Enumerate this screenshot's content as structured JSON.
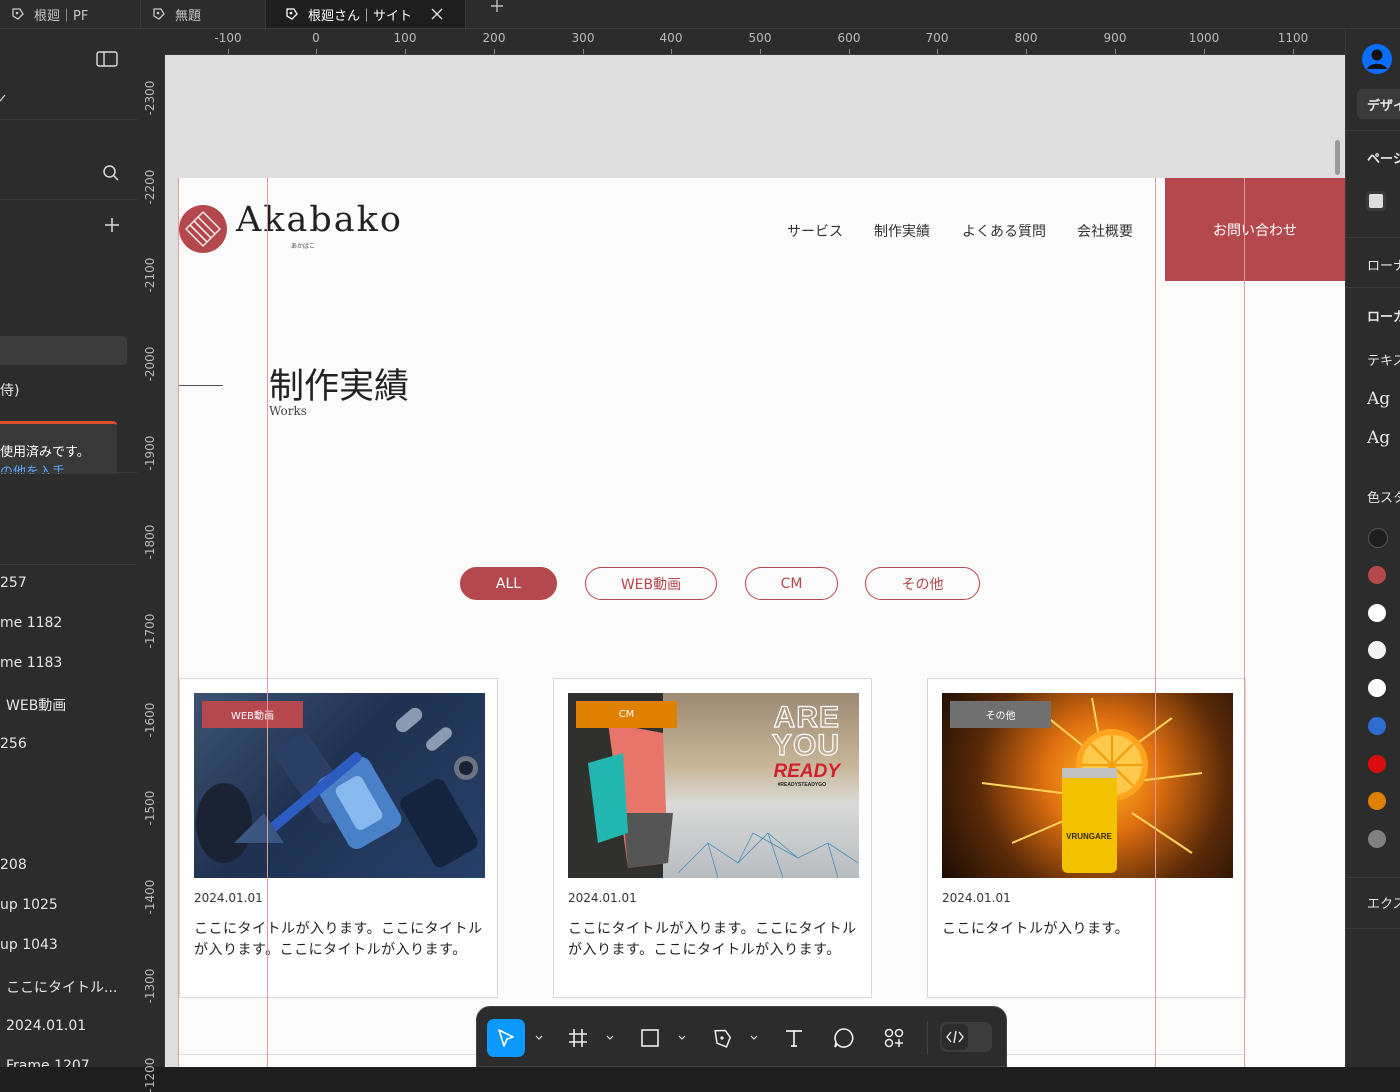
{
  "tabs": [
    {
      "label": "根廻｜PF",
      "active": false
    },
    {
      "label": "無題",
      "active": false
    },
    {
      "label": "根廻さん｜サイト",
      "active": true
    }
  ],
  "left_panel": {
    "layer_items": [
      "侍)",
      "257",
      "me 1182",
      "me 1183",
      "WEB動画",
      "256",
      "208",
      "up 1025",
      "up 1043",
      "ここにタイトル...",
      "2024.01.01",
      "Frame 1207"
    ],
    "notice_line1": "使用済みです。",
    "notice_line2": "の他を入手"
  },
  "rulers": {
    "h_labels": [
      "-100",
      "0",
      "100",
      "200",
      "300",
      "400",
      "500",
      "600",
      "700",
      "800",
      "900",
      "1000",
      "1100"
    ],
    "v_labels": [
      "-2300",
      "-2200",
      "-2100",
      "-2000",
      "-1900",
      "-1800",
      "-1700",
      "-1600",
      "-1500",
      "-1400",
      "-1300",
      "-1200"
    ]
  },
  "site": {
    "logo_text": "Akabako",
    "logo_sub": "あかばこ",
    "nav": [
      "サービス",
      "制作実績",
      "よくある質問",
      "会社概要"
    ],
    "contact_button": "お問い合わせ",
    "heading": "制作実績",
    "heading_sub": "Works",
    "filters": [
      "ALL",
      "WEB動画",
      "CM",
      "その他"
    ],
    "cards": [
      {
        "badge": "WEB動画",
        "badge_color": "#b5484c",
        "date": "2024.01.01",
        "title": "ここにタイトルが入ります。ここにタイトルが入ります。ここにタイトルが入ります。"
      },
      {
        "badge": "CM",
        "badge_color": "#e08000",
        "date": "2024.01.01",
        "title": "ここにタイトルが入ります。ここにタイトルが入ります。ここにタイトルが入ります。",
        "image_text": [
          "ARE",
          "YOU",
          "READY",
          "#READYSTEADYGO"
        ]
      },
      {
        "badge": "その他",
        "badge_color": "#707070",
        "date": "2024.01.01",
        "title": "ここにタイトルが入ります。",
        "image_text": "VRUNGARE"
      }
    ]
  },
  "right_panel": {
    "design_tab": "デザイ",
    "page_label": "ペーシ",
    "local1": "ローナ",
    "local2": "ローカ",
    "text_styles": "テキス",
    "ag1": "Ag",
    "ag2": "Ag",
    "color_styles": "色スタ",
    "export": "エクス",
    "swatches": [
      "#1e1e1e",
      "#b5484c",
      "#ffffff",
      "#f2f2f2",
      "#ffffff",
      "#2f6bd0",
      "#d90d0d",
      "#e08000",
      "#808080"
    ]
  },
  "colors": {
    "accent": "#b5484c",
    "tool_active": "#0d99ff"
  },
  "toolbar": {
    "tools": [
      "move-tool",
      "frame-tool",
      "shape-tool",
      "pen-tool",
      "text-tool",
      "comment-tool",
      "actions-tool",
      "dev-mode-toggle"
    ]
  }
}
